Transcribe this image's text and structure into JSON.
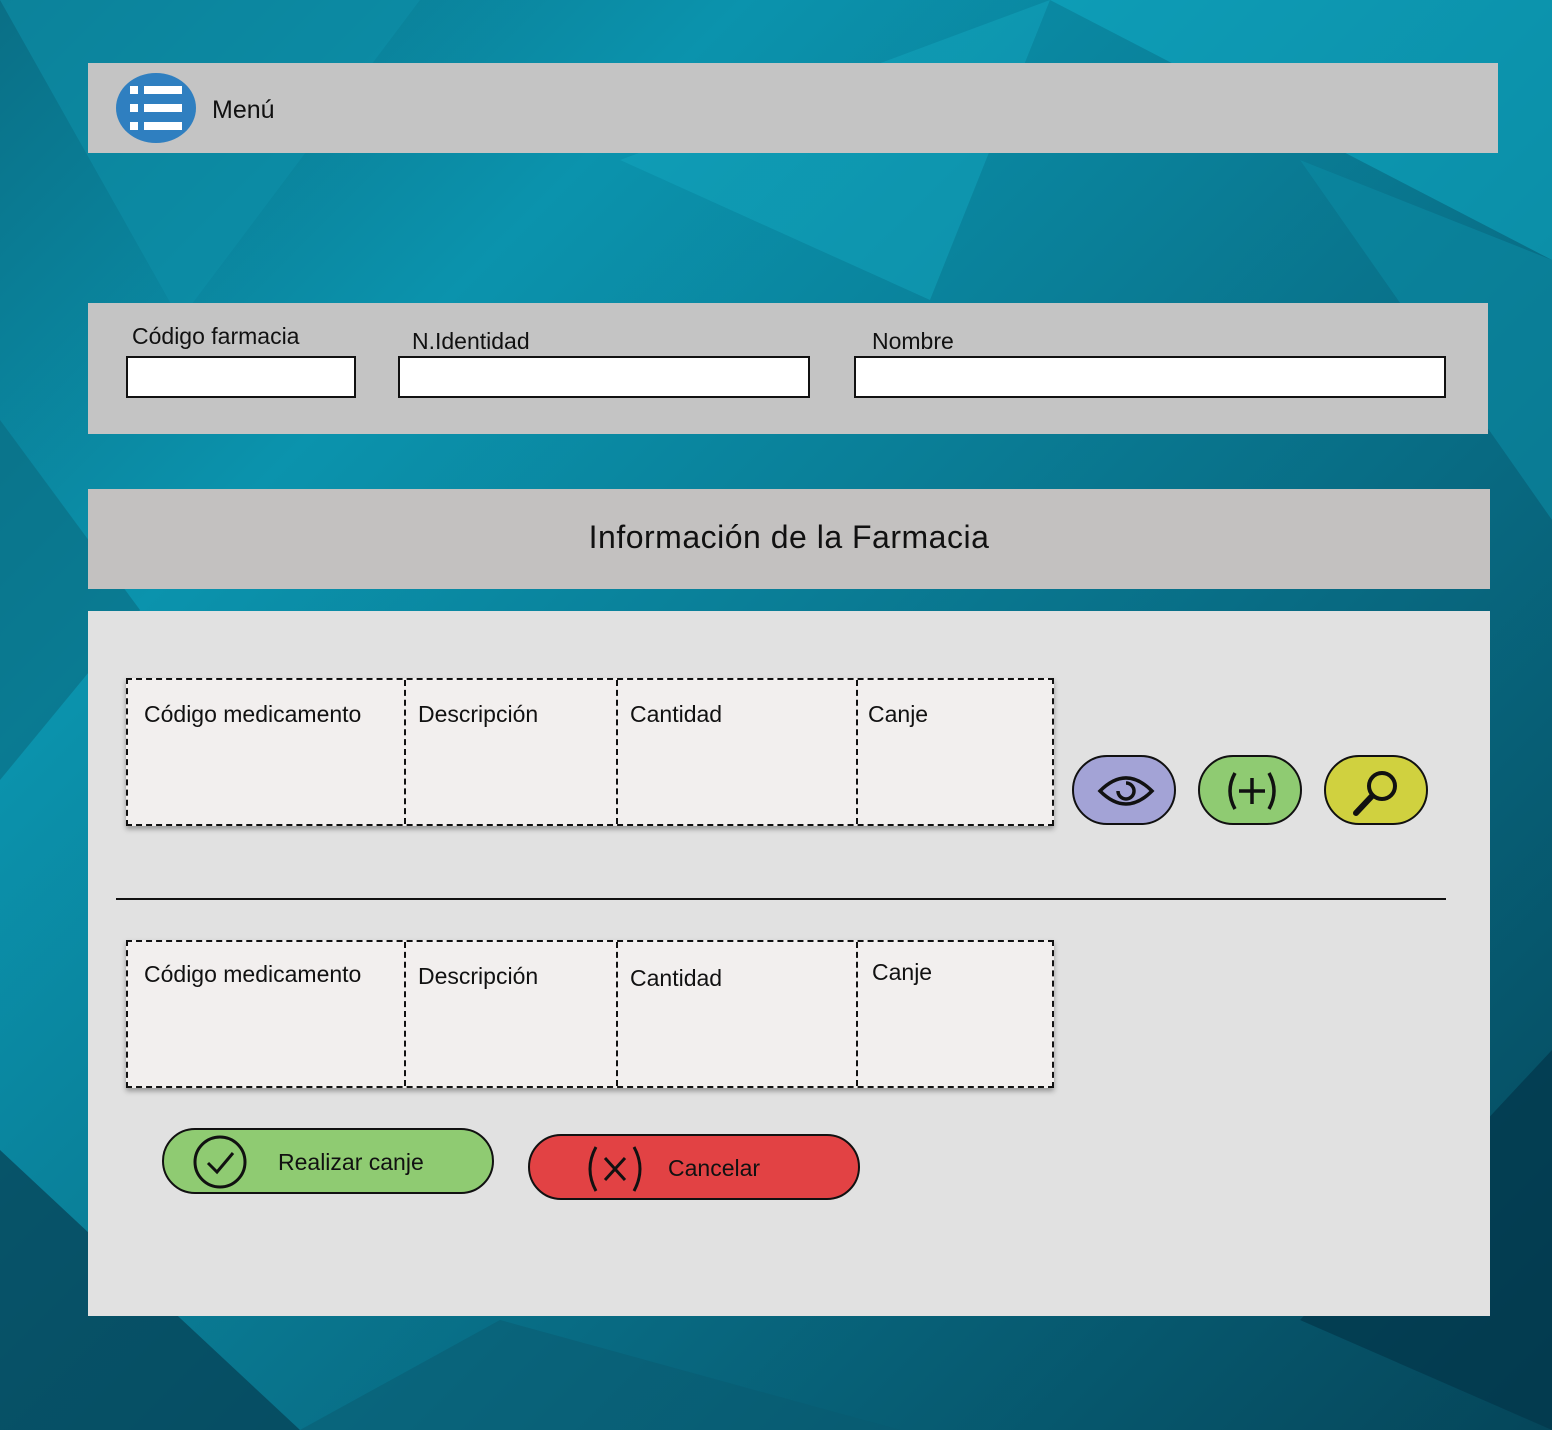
{
  "menu": {
    "label": "Menú"
  },
  "identity": {
    "pharmacy_code_label": "Código farmacia",
    "id_number_label": "N.Identidad",
    "name_label": "Nombre",
    "pharmacy_code_value": "",
    "id_number_value": "",
    "name_value": ""
  },
  "section_title": "Información de la Farmacia",
  "tables": [
    {
      "columns": [
        "Código medicamento",
        "Descripción",
        "Cantidad",
        "Canje"
      ],
      "rows": []
    },
    {
      "columns": [
        "Código medicamento",
        "Descripción",
        "Cantidad",
        "Canje"
      ],
      "rows": []
    }
  ],
  "icon_buttons": [
    {
      "icon": "eye-icon",
      "color": "#a3a3d6"
    },
    {
      "icon": "plus-icon",
      "color": "#8fcb72"
    },
    {
      "icon": "search-icon",
      "color": "#d0d13f"
    }
  ],
  "actions": {
    "confirm_label": "Realizar canje",
    "confirm_color": "#8fcb72",
    "cancel_label": "Cancelar",
    "cancel_color": "#e24244"
  }
}
